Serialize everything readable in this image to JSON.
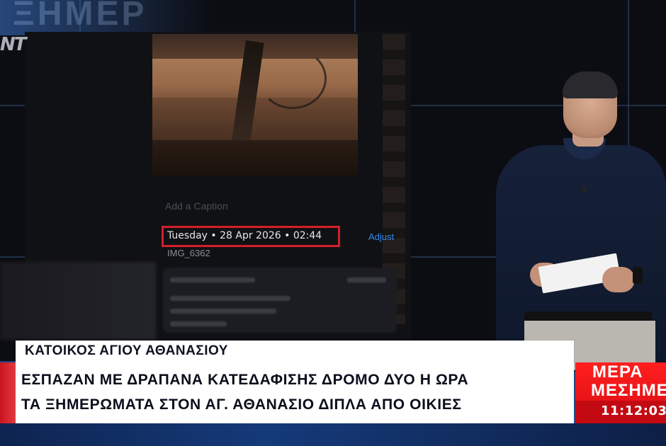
{
  "channel": {
    "logo_text": "NT"
  },
  "screen": {
    "caption_placeholder": "Add a Caption",
    "datetime": "Tuesday • 28 Apr 2026 • 02:44",
    "adjust_label": "Adjust",
    "file_name": "IMG_6362"
  },
  "lower_third": {
    "kicker": "ΚΑΤΟΙΚΟΣ ΑΓΙΟΥ ΑΘΑΝΑΣΙΟΥ",
    "headline_line1": "ΕΣΠΑΖΑΝ ΜΕ ΔΡΑΠΑΝΑ ΚΑΤΕΔΑΦΙΣΗΣ ΔΡΟΜΟ ΔΥΟ Η ΩΡΑ",
    "headline_line2": "ΤΑ ΞΗΜΕΡΩΜΑΤΑ ΣΤΟΝ ΑΓ. ΑΘΑΝΑΣΙΟ ΔΙΠΛΑ ΑΠΟ ΟΙΚΙΕΣ"
  },
  "show_badge": {
    "line1": "ΜΕΡΑ",
    "line2": "ΜΕΣΗΜΕ",
    "clock": "11:12:03"
  },
  "background_word": "ΞΗΜΕΡ",
  "colors": {
    "highlight_box": "#d41f2a",
    "badge_red": "#e0141a",
    "link_blue": "#2e8bf0"
  }
}
